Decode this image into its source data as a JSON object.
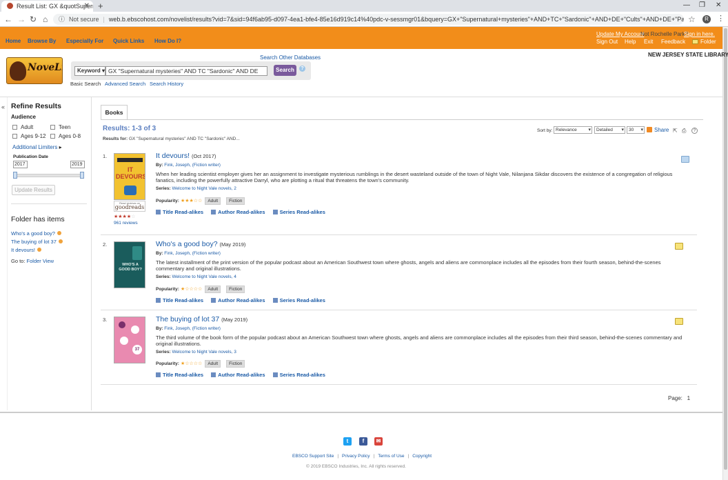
{
  "browser": {
    "tab_title": "Result List: GX &quotSupernatu",
    "tab_close": "✕",
    "new_tab": "+",
    "not_secure": "Not secure",
    "url": "web.b.ebscohost.com/novelist/results?vid=7&sid=94f6ab95-d097-4ea1-bfe4-85e16d919c14%40pdc-v-sessmgr01&bquery=GX+\"Supernatural+mysteries\"+AND+TC+\"Sardonic\"+AND+DE+\"Cults\"+AND+DE+\"Paranormal+phenomena\"+AND+ND+\"...",
    "profile_initial": "R"
  },
  "header": {
    "nav": [
      "Home",
      "Browse By",
      "Especially For",
      "Quick Links",
      "How Do I?"
    ],
    "update_account": "Update My Account",
    "not_user": "Not Rochelle Park?",
    "sign_in": "Sign in here.",
    "links": [
      "Sign Out",
      "Help",
      "Exit",
      "Feedback",
      "Folder"
    ],
    "library": "NEW JERSEY STATE LIBRARY"
  },
  "logo": {
    "text": "NoveList"
  },
  "search": {
    "other_databases": "Search Other Databases",
    "field": "Keyword",
    "query": "GX \"Supernatural mysteries\" AND TC \"Sardonic\" AND DE",
    "button": "Search",
    "help": "?",
    "basic": "Basic Search",
    "advanced": "Advanced Search",
    "history": "Search History"
  },
  "sidebar": {
    "collapse": "«",
    "refine": "Refine Results",
    "audience": "Audience",
    "audience_options": [
      "Adult",
      "Teen",
      "Ages 9-12",
      "Ages 0-8"
    ],
    "additional": "Additional Limiters",
    "pub_date": "Publication Date",
    "year_from": "2017",
    "year_to": "2019",
    "update": "Update Results",
    "folder_has": "Folder has items",
    "folder_items": [
      "Who's a good boy?",
      "The buying of lot 37",
      "It devours!"
    ],
    "go_to": "Go to:",
    "folder_view": "Folder View"
  },
  "results": {
    "tab": "Books",
    "count": "Results: 1-3 of 3",
    "results_for_label": "Results for:",
    "results_for": "GX \"Supernatural mysteries\" AND TC \"Sardonic\" AND...",
    "sort_label": "Sort by:",
    "sort_value": "Relevance",
    "view_value": "Detailed",
    "per_page": "30",
    "share": "Share",
    "help": "?",
    "by_label": "By:",
    "series_label": "Series:",
    "popularity_label": "Popularity:",
    "readalikes": [
      "Title Read-alikes",
      "Author Read-alikes",
      "Series Read-alikes"
    ],
    "items": [
      {
        "num": "1.",
        "title": "It devours!",
        "date": "(Oct 2017)",
        "author": "Fink, Joseph, (Fiction writer)",
        "description": "When her leading scientist employer gives her an assignment to investigate mysterious rumblings in the desert wasteland outside of the town of Night Vale, Nilanjana Sikdar discovers the existence of a congregation of religious fanatics, including the powerfully attractive Darryl, who are plotting a ritual that threatens the town's community.",
        "series": "Welcome to Night Vale novels, 2",
        "popularity": 3,
        "tags": [
          "Adult",
          "Fiction"
        ],
        "cover_color": "#f2c230",
        "cover_text": "IT DEVOURS!",
        "goodreads_caption": "Read reviews on",
        "goodreads_name": "goodreads",
        "goodreads_rating": 4,
        "reviews": "961 reviews"
      },
      {
        "num": "2.",
        "title": "Who's a good boy?",
        "date": "(May 2019)",
        "author": "Fink, Joseph, (Fiction writer)",
        "description": "The latest installment of the print version of the popular podcast about an American Southwest town where ghosts, angels and aliens are commonplace includes all the episodes from their fourth season, behind-the-scenes commentary and original illustrations.",
        "series": "Welcome to Night Vale novels, 4",
        "popularity": 1,
        "tags": [
          "Adult",
          "Fiction"
        ],
        "cover_color": "#1a5c5c",
        "cover_text": "WHO'S A GOOD BOY?"
      },
      {
        "num": "3.",
        "title": "The buying of lot 37",
        "date": "(May 2019)",
        "author": "Fink, Joseph, (Fiction writer)",
        "description": "The third volume of the book form of the popular podcast about an American Southwest town where ghosts, angels and aliens are commonplace includes all the episodes from their third season, behind-the-scenes commentary and original illustrations.",
        "series": "Welcome to Night Vale novels, 3",
        "popularity": 1,
        "tags": [
          "Adult",
          "Fiction"
        ],
        "cover_color": "#e98ab0",
        "cover_text": "37"
      }
    ],
    "page_label": "Page:",
    "page": "1"
  },
  "footer": {
    "links": [
      "EBSCO Support Site",
      "Privacy Policy",
      "Terms of Use",
      "Copyright"
    ],
    "copyright": "© 2019 EBSCO Industries, Inc. All rights reserved."
  },
  "colors": {
    "orange": "#f28d1a",
    "link": "#1a5aa6",
    "purple_button": "#7a5a9c"
  }
}
